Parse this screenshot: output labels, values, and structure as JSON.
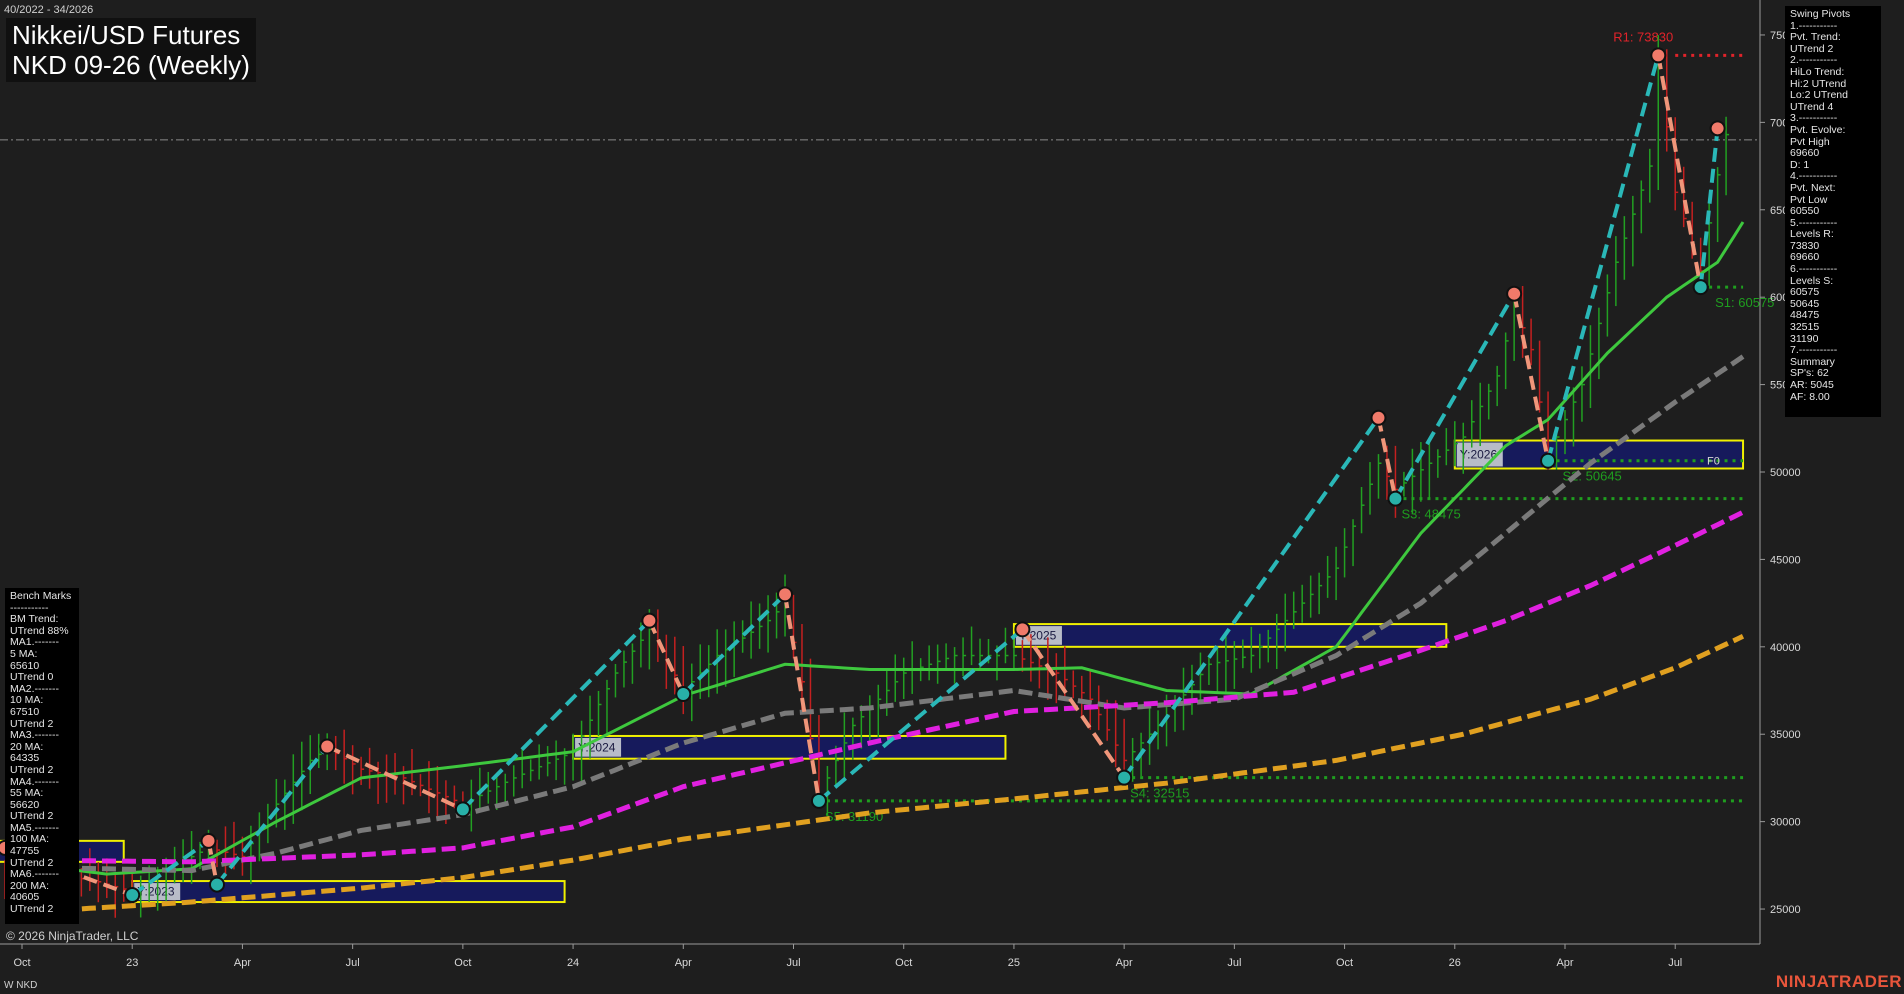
{
  "header": {
    "date_range": "40/2022 - 34/2026",
    "title_line1": "Nikkei/USD Futures",
    "title_line2": "NKD 09-26 (Weekly)"
  },
  "footer": {
    "copyright": "© 2026 NinjaTrader, LLC",
    "symbol": "W NKD",
    "brand": "NINJATRADER"
  },
  "swing_panel": {
    "lines": [
      "Swing Pivots",
      "1.-----------",
      "Pvt. Trend:",
      "UTrend 2",
      "2.-----------",
      "HiLo Trend:",
      "Hi:2 UTrend",
      "Lo:2 UTrend",
      "UTrend 4",
      "3.-----------",
      "Pvt. Evolve:",
      "Pvt High",
      "69660",
      "D: 1",
      "4.-----------",
      "Pvt. Next:",
      "Pvt Low",
      "60550",
      "5.-----------",
      "Levels R:",
      "73830",
      "69660",
      "6.-----------",
      "Levels S:",
      "60575",
      "50645",
      "48475",
      "32515",
      "31190",
      "7.-----------",
      "Summary",
      "SP's: 62",
      "AR: 5045",
      "AF: 8.00"
    ]
  },
  "bench_panel": {
    "lines": [
      "Bench Marks",
      "-----------",
      "BM Trend:",
      "UTrend 88%",
      "MA1.-------",
      "5 MA:",
      "65610",
      "UTrend 0",
      "MA2.-------",
      "10 MA:",
      "67510",
      "UTrend 2",
      "MA3.-------",
      "20 MA:",
      "64335",
      "UTrend 2",
      "MA4.-------",
      "55 MA:",
      "56620",
      "UTrend 2",
      "MA5.-------",
      "100 MA:",
      "47755",
      "UTrend 2",
      "MA6.-------",
      "200 MA:",
      "40605",
      "UTrend 2"
    ]
  },
  "colors": {
    "background": "#1e1e1e",
    "resistance": "#e0232a",
    "support": "#1f9e1f",
    "ma_green": "#3ec83e",
    "ma_gray": "#7a7a7a",
    "ma_magenta": "#e020e0",
    "ma_orange": "#e0a020",
    "swing_up": "#2ab8b8",
    "swing_down": "#f0967a",
    "year_box_fill": "#161a5c",
    "year_box_border": "#f0f000"
  },
  "chart_data": {
    "type": "candlestick-line",
    "title": "Nikkei/USD Futures NKD 09-26 (Weekly)",
    "ylim": [
      23000,
      77000
    ],
    "y_ticks": [
      25000,
      30000,
      35000,
      40000,
      45000,
      50000,
      55000,
      60000,
      65000,
      70000,
      75000
    ],
    "x_ticks": [
      {
        "label": "Oct",
        "t": 0
      },
      {
        "label": "23",
        "t": 13
      },
      {
        "label": "Apr",
        "t": 26
      },
      {
        "label": "Jul",
        "t": 39
      },
      {
        "label": "Oct",
        "t": 52
      },
      {
        "label": "24",
        "t": 65
      },
      {
        "label": "Apr",
        "t": 78
      },
      {
        "label": "Jul",
        "t": 91
      },
      {
        "label": "Oct",
        "t": 104
      },
      {
        "label": "25",
        "t": 117
      },
      {
        "label": "Apr",
        "t": 130
      },
      {
        "label": "Jul",
        "t": 143
      },
      {
        "label": "Oct",
        "t": 156
      },
      {
        "label": "26",
        "t": 169
      },
      {
        "label": "Apr",
        "t": 182
      },
      {
        "label": "Jul",
        "t": 195
      }
    ],
    "t_range": [
      0,
      205
    ],
    "dash_dot_level": 69000,
    "swing_pivots": [
      {
        "t": -2,
        "v": 28500,
        "kind": "high"
      },
      {
        "t": 13,
        "v": 25800,
        "kind": "low"
      },
      {
        "t": 22,
        "v": 28900,
        "kind": "high"
      },
      {
        "t": 23,
        "v": 26400,
        "kind": "low"
      },
      {
        "t": 36,
        "v": 34300,
        "kind": "high"
      },
      {
        "t": 52,
        "v": 30700,
        "kind": "low"
      },
      {
        "t": 74,
        "v": 41500,
        "kind": "high"
      },
      {
        "t": 78,
        "v": 37300,
        "kind": "low"
      },
      {
        "t": 90,
        "v": 43000,
        "kind": "high"
      },
      {
        "t": 94,
        "v": 31190,
        "kind": "low"
      },
      {
        "t": 118,
        "v": 41000,
        "kind": "high"
      },
      {
        "t": 130,
        "v": 32515,
        "kind": "low"
      },
      {
        "t": 160,
        "v": 53100,
        "kind": "high"
      },
      {
        "t": 162,
        "v": 48475,
        "kind": "low"
      },
      {
        "t": 176,
        "v": 60200,
        "kind": "high"
      },
      {
        "t": 180,
        "v": 50645,
        "kind": "low"
      },
      {
        "t": 193,
        "v": 73830,
        "kind": "high"
      },
      {
        "t": 198,
        "v": 60575,
        "kind": "low"
      },
      {
        "t": 200,
        "v": 69660,
        "kind": "high"
      }
    ],
    "levels": [
      {
        "label": "R1: 73830",
        "value": 73830,
        "type": "resistance",
        "t_start": 195,
        "t_end": 203
      },
      {
        "label": "S1: 60575",
        "value": 60575,
        "type": "support",
        "t_start": 199,
        "t_end": 203
      },
      {
        "label": "S2: 50645",
        "value": 50645,
        "type": "support",
        "t_start": 181,
        "t_end": 203
      },
      {
        "label": "S3: 48475",
        "value": 48475,
        "type": "support",
        "t_start": 162,
        "t_end": 203
      },
      {
        "label": "S4: 32515",
        "value": 32515,
        "type": "support",
        "t_start": 130,
        "t_end": 203
      },
      {
        "label": "S5: 31190",
        "value": 31190,
        "type": "support",
        "t_start": 94,
        "t_end": 203
      }
    ],
    "year_boxes": [
      {
        "label": "Y:2023",
        "t0": 13,
        "t1": 64,
        "v_low": 25400,
        "v_high": 26600
      },
      {
        "label": "Y:2024",
        "t0": 65,
        "t1": 116,
        "v_low": 33600,
        "v_high": 34900
      },
      {
        "label": "Y:2025",
        "t0": 117,
        "t1": 168,
        "v_low": 40000,
        "v_high": 41300
      },
      {
        "label": "Y:2026",
        "t0": 169,
        "t1": 203,
        "v_low": 50200,
        "v_high": 51800
      }
    ],
    "prior_box": {
      "t0": -3,
      "t1": 12,
      "v_low": 27700,
      "v_high": 28900
    },
    "fib_label": "F0",
    "ma_series": [
      {
        "name": "20 MA",
        "color_key": "ma_green",
        "dash": false,
        "points": [
          [
            0,
            27600
          ],
          [
            10,
            27000
          ],
          [
            20,
            27300
          ],
          [
            30,
            30000
          ],
          [
            40,
            32500
          ],
          [
            52,
            33200
          ],
          [
            65,
            34000
          ],
          [
            78,
            37200
          ],
          [
            90,
            39000
          ],
          [
            100,
            38700
          ],
          [
            117,
            38700
          ],
          [
            125,
            38800
          ],
          [
            135,
            37500
          ],
          [
            145,
            37300
          ],
          [
            155,
            40000
          ],
          [
            165,
            46500
          ],
          [
            175,
            51500
          ],
          [
            180,
            53000
          ],
          [
            187,
            56800
          ],
          [
            194,
            60000
          ],
          [
            200,
            62000
          ],
          [
            203,
            64300
          ]
        ]
      },
      {
        "name": "55 MA",
        "color_key": "ma_gray",
        "dash": true,
        "points": [
          [
            0,
            27400
          ],
          [
            20,
            27200
          ],
          [
            30,
            28200
          ],
          [
            40,
            29500
          ],
          [
            52,
            30400
          ],
          [
            65,
            32000
          ],
          [
            78,
            34500
          ],
          [
            90,
            36200
          ],
          [
            100,
            36500
          ],
          [
            117,
            37500
          ],
          [
            130,
            36500
          ],
          [
            143,
            37000
          ],
          [
            155,
            39500
          ],
          [
            165,
            42500
          ],
          [
            175,
            46500
          ],
          [
            185,
            50500
          ],
          [
            195,
            54000
          ],
          [
            203,
            56600
          ]
        ]
      },
      {
        "name": "100 MA",
        "color_key": "ma_magenta",
        "dash": true,
        "points": [
          [
            0,
            27800
          ],
          [
            20,
            27700
          ],
          [
            40,
            28100
          ],
          [
            52,
            28500
          ],
          [
            65,
            29700
          ],
          [
            78,
            32000
          ],
          [
            100,
            34500
          ],
          [
            117,
            36300
          ],
          [
            135,
            36800
          ],
          [
            150,
            37400
          ],
          [
            165,
            39800
          ],
          [
            175,
            41500
          ],
          [
            185,
            43500
          ],
          [
            195,
            45800
          ],
          [
            203,
            47700
          ]
        ]
      },
      {
        "name": "200 MA",
        "color_key": "ma_orange",
        "dash": true,
        "points": [
          [
            0,
            24800
          ],
          [
            20,
            25400
          ],
          [
            40,
            26200
          ],
          [
            52,
            26800
          ],
          [
            65,
            27800
          ],
          [
            78,
            29000
          ],
          [
            100,
            30500
          ],
          [
            117,
            31300
          ],
          [
            135,
            32200
          ],
          [
            155,
            33500
          ],
          [
            170,
            35000
          ],
          [
            185,
            37000
          ],
          [
            195,
            38800
          ],
          [
            203,
            40600
          ]
        ]
      }
    ],
    "price_path": [
      [
        -5,
        27500
      ],
      [
        0,
        27000
      ],
      [
        8,
        26700
      ],
      [
        13,
        26000
      ],
      [
        18,
        27500
      ],
      [
        22,
        28500
      ],
      [
        26,
        28000
      ],
      [
        30,
        31000
      ],
      [
        34,
        33500
      ],
      [
        36,
        34200
      ],
      [
        40,
        33000
      ],
      [
        45,
        32500
      ],
      [
        52,
        31000
      ],
      [
        58,
        32500
      ],
      [
        65,
        34000
      ],
      [
        70,
        38500
      ],
      [
        74,
        41000
      ],
      [
        78,
        37500
      ],
      [
        82,
        39500
      ],
      [
        88,
        41500
      ],
      [
        90,
        42500
      ],
      [
        92,
        38000
      ],
      [
        94,
        31500
      ],
      [
        98,
        35500
      ],
      [
        104,
        38500
      ],
      [
        110,
        39500
      ],
      [
        117,
        39500
      ],
      [
        122,
        38500
      ],
      [
        126,
        37000
      ],
      [
        130,
        33500
      ],
      [
        134,
        35500
      ],
      [
        140,
        39000
      ],
      [
        145,
        39500
      ],
      [
        150,
        42000
      ],
      [
        155,
        44500
      ],
      [
        160,
        50500
      ],
      [
        162,
        49000
      ],
      [
        166,
        50500
      ],
      [
        170,
        52000
      ],
      [
        174,
        55500
      ],
      [
        176,
        59500
      ],
      [
        178,
        57000
      ],
      [
        180,
        51000
      ],
      [
        184,
        55000
      ],
      [
        188,
        62000
      ],
      [
        192,
        67500
      ],
      [
        193,
        73500
      ],
      [
        195,
        66000
      ],
      [
        197,
        63000
      ],
      [
        198,
        61500
      ],
      [
        200,
        67000
      ],
      [
        201,
        69300
      ]
    ]
  }
}
